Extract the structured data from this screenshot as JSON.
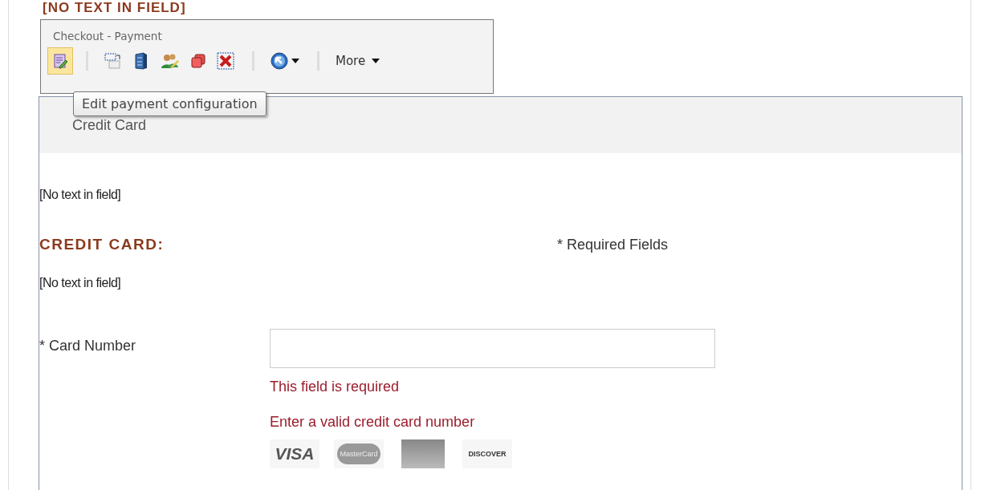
{
  "page_heading": "[NO TEXT IN FIELD]",
  "toolbar": {
    "title": "Checkout - Payment",
    "tools": [
      {
        "kind": "edit",
        "selected": true
      },
      {
        "kind": "sep"
      },
      {
        "kind": "dotted",
        "selected": false
      },
      {
        "kind": "cabinet",
        "selected": false
      },
      {
        "kind": "people",
        "selected": false
      },
      {
        "kind": "squares",
        "selected": false
      },
      {
        "kind": "delete",
        "selected": false
      },
      {
        "kind": "sep"
      },
      {
        "kind": "circle",
        "selected": false
      },
      {
        "kind": "sep"
      }
    ],
    "more": "More",
    "tooltip": "Edit payment configuration"
  },
  "panel": {
    "title": "Credit Card",
    "notice_1": "[No text in field]",
    "section_heading": "CREDIT CARD:",
    "required_note": "* Required Fields",
    "notice_2": "[No text in field]",
    "card_number": {
      "label": "* Card Number",
      "errors": [
        "This field is required",
        "Enter a valid credit card number"
      ]
    },
    "cards": [
      {
        "kind": "visa",
        "label": "VISA"
      },
      {
        "kind": "mastercard",
        "label": "MasterCard"
      },
      {
        "kind": "amex"
      },
      {
        "kind": "discover",
        "label": "DISCOVER"
      }
    ]
  }
}
